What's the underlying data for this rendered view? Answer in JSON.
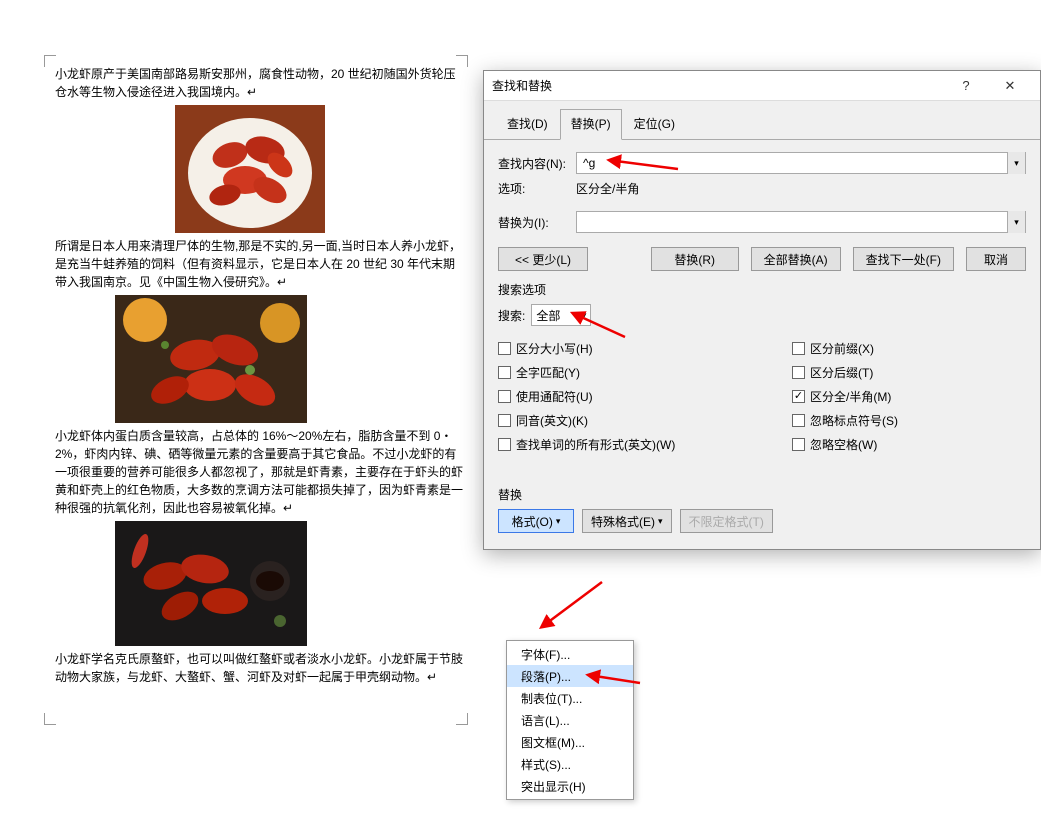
{
  "doc": {
    "p1": "小龙虾原产于美国南部路易斯安那州，腐食性动物，20 世纪初随国外货轮压仓水等生物入侵途径进入我国境内。↵",
    "p2": "所谓是日本人用来清理尸体的生物,那是不实的,另一面,当时日本人养小龙虾，是充当牛蛙养殖的饲料（但有资料显示，它是日本人在 20 世纪 30 年代末期带入我国南京。见《中国生物入侵研究》。↵",
    "p3": "小龙虾体内蛋白质含量较高，占总体的 16%～20%左右，脂肪含量不到 0・2%，虾肉内锌、碘、硒等微量元素的含量要高于其它食品。不过小龙虾的有一项很重要的营养可能很多人都忽视了，那就是虾青素，主要存在于虾头的虾黄和虾壳上的红色物质，大多数的烹调方法可能都损失掉了，因为虾青素是一种很强的抗氧化剂，因此也容易被氧化掉。↵",
    "p4": "小龙虾学名克氏原螯虾，也可以叫做红螯虾或者淡水小龙虾。小龙虾属于节肢动物大家族，与龙虾、大螯虾、蟹、河虾及对虾一起属于甲壳纲动物。↵"
  },
  "dialog": {
    "title": "查找和替换",
    "help_icon": "?",
    "close_icon": "✕",
    "tabs": {
      "find": "查找(D)",
      "replace": "替换(P)",
      "goto": "定位(G)"
    },
    "find_label": "查找内容(N):",
    "find_value": "^g",
    "options_label": "选项:",
    "options_value": "区分全/半角",
    "replace_label": "替换为(I):",
    "replace_value": "",
    "btn_less": "<< 更少(L)",
    "btn_replace": "替换(R)",
    "btn_replace_all": "全部替换(A)",
    "btn_find_next": "查找下一处(F)",
    "btn_cancel": "取消",
    "search_options": "搜索选项",
    "search_label": "搜索:",
    "search_value": "全部",
    "cb_left": [
      "区分大小写(H)",
      "全字匹配(Y)",
      "使用通配符(U)",
      "同音(英文)(K)",
      "查找单词的所有形式(英文)(W)"
    ],
    "cb_right": [
      "区分前缀(X)",
      "区分后缀(T)",
      "区分全/半角(M)",
      "忽略标点符号(S)",
      "忽略空格(W)"
    ],
    "replace_section": "替换",
    "btn_format": "格式(O)",
    "btn_special": "特殊格式(E)",
    "btn_noformat": "不限定格式(T)"
  },
  "menu": {
    "items": [
      "字体(F)...",
      "段落(P)...",
      "制表位(T)...",
      "语言(L)...",
      "图文框(M)...",
      "样式(S)...",
      "突出显示(H)"
    ]
  }
}
